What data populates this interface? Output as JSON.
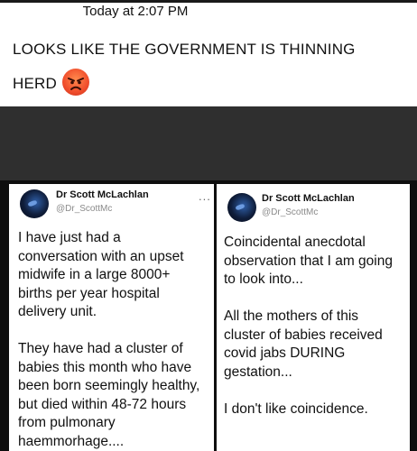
{
  "message": {
    "timestamp": "Today at 2:07 PM",
    "text_line1": "LOOKS LIKE THE GOVERNMENT IS THINNING",
    "text_line2": "HERD",
    "emoji": "angry-face-icon"
  },
  "colors": {
    "background": "#ffffff",
    "band": "#2f2f2f",
    "frame": "#0e0e0e",
    "emoji": "#f04d2c",
    "handle": "#8a8a8a"
  },
  "tweets": [
    {
      "author": "Dr Scott McLachlan",
      "handle": "@Dr_ScottMc",
      "more": "...",
      "lines": [
        "I have just had a",
        "conversation with an upset",
        "midwife in a large 8000+",
        "births per year hospital",
        "delivery unit.",
        "",
        "They have had a cluster of",
        "babies this month who have",
        "been born seemingly healthy,",
        "but died within 48-72 hours",
        "from pulmonary",
        "haemmorhage...."
      ]
    },
    {
      "author": "Dr Scott McLachlan",
      "handle": "@Dr_ScottMc",
      "lines": [
        "Coincidental anecdotal",
        "observation that I am going",
        "to look into...",
        "",
        "All the mothers of this",
        "cluster of babies received",
        "covid jabs DURING",
        "gestation...",
        "",
        "I don't like coincidence."
      ]
    }
  ]
}
